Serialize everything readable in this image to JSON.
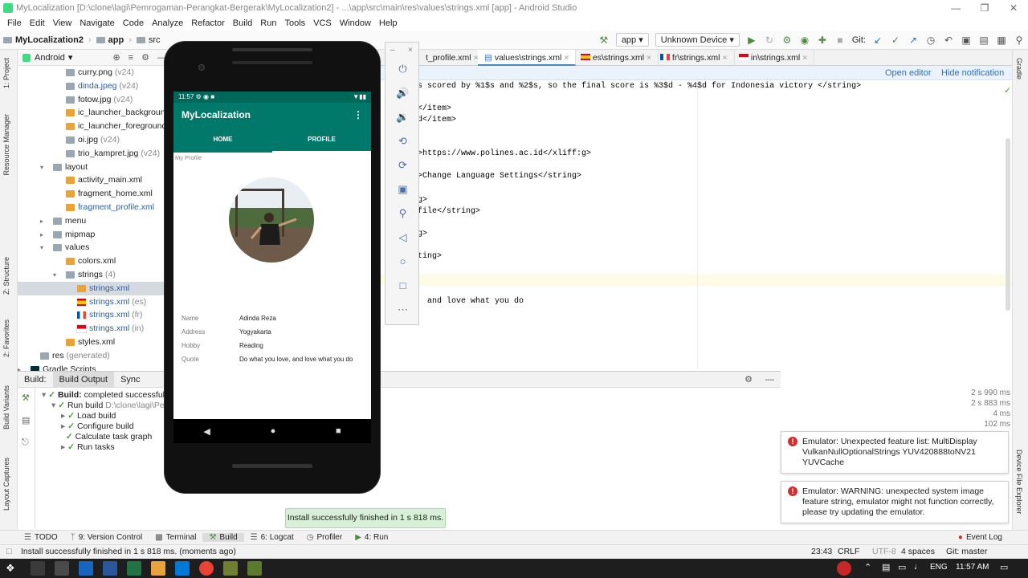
{
  "window": {
    "title": "MyLocalization [D:\\clone\\lagi\\Pemrogaman-Perangkat-Bergerak\\MyLocalization2] - ...\\app\\src\\main\\res\\values\\strings.xml [app] - Android Studio"
  },
  "menu": [
    "File",
    "Edit",
    "View",
    "Navigate",
    "Code",
    "Analyze",
    "Refactor",
    "Build",
    "Run",
    "Tools",
    "VCS",
    "Window",
    "Help"
  ],
  "breadcrumb": [
    "MyLocalization2",
    "app",
    "src",
    "main",
    "res",
    "values",
    "strings.xml"
  ],
  "toolbar": {
    "config": "app",
    "device": "Unknown Device",
    "git": "Git:"
  },
  "project": {
    "view": "Android",
    "items": [
      {
        "label": "curry.png",
        "suffix": "(v24)"
      },
      {
        "label": "dinda.jpeg",
        "suffix": "(v24)"
      },
      {
        "label": "fotow.jpg",
        "suffix": "(v24)"
      },
      {
        "label": "ic_launcher_background.",
        "suffix": ""
      },
      {
        "label": "ic_launcher_foreground.x",
        "suffix": ""
      },
      {
        "label": "oi.jpg",
        "suffix": "(v24)"
      },
      {
        "label": "trio_kampret.jpg",
        "suffix": "(v24)"
      },
      {
        "label": "layout",
        "suffix": ""
      },
      {
        "label": "activity_main.xml",
        "suffix": ""
      },
      {
        "label": "fragment_home.xml",
        "suffix": ""
      },
      {
        "label": "fragment_profile.xml",
        "suffix": ""
      },
      {
        "label": "menu",
        "suffix": ""
      },
      {
        "label": "mipmap",
        "suffix": ""
      },
      {
        "label": "values",
        "suffix": ""
      },
      {
        "label": "colors.xml",
        "suffix": ""
      },
      {
        "label": "strings",
        "suffix": "(4)"
      },
      {
        "label": "strings.xml",
        "suffix": ""
      },
      {
        "label": "strings.xml",
        "suffix": "(es)"
      },
      {
        "label": "strings.xml",
        "suffix": "(fr)"
      },
      {
        "label": "strings.xml",
        "suffix": "(in)"
      },
      {
        "label": "styles.xml",
        "suffix": ""
      },
      {
        "label": "res",
        "suffix": "(generated)"
      },
      {
        "label": "Gradle Scripts",
        "suffix": ""
      }
    ]
  },
  "tabs": [
    "t_profile.xml",
    "values\\strings.xml",
    "es\\strings.xml",
    "fr\\strings.xml",
    "in\\strings.xml"
  ],
  "editor": {
    "open_editor": "Open editor",
    "hide_notification": "Hide notification",
    "lines": [
      "s scored by %1$s and %2$s, so the final score is %3$d - %4$d for Indonesia victory </string>",
      "</item>",
      "d</item>",
      ">https://www.polines.ac.id</xliff:g>",
      ">Change Language Settings</string>",
      "g>",
      "file</string>",
      "g>",
      "ting>",
      "and love what you do"
    ]
  },
  "left_tools": [
    "1: Project",
    "Resource Manager",
    "Z: Structure",
    "2: Favorites",
    "Build Variants",
    "Layout Captures"
  ],
  "right_tools": [
    "Gradle",
    "Device File Explorer"
  ],
  "build": {
    "tabs": [
      "Build:",
      "Build Output",
      "Sync"
    ],
    "rows": [
      {
        "label": "Build:",
        "text": "completed successfully",
        "time": "2 s 990 ms"
      },
      {
        "label": "Run build",
        "text": "D:\\clone\\lagi\\Pe",
        "time": "2 s 883 ms"
      },
      {
        "label": "Load build",
        "text": "",
        "time": "4 ms"
      },
      {
        "label": "Configure build",
        "text": "",
        "time": "102 ms"
      },
      {
        "label": "Calculate task graph",
        "text": "",
        "time": ""
      },
      {
        "label": "Run tasks",
        "text": "",
        "time": ""
      }
    ]
  },
  "notifications": [
    "Emulator: Unexpected feature list: MultiDisplay VulkanNullOptionalStrings YUV420888toNV21 YUVCache",
    "Emulator: WARNING: unexpected system image feature string, emulator might not function correctly, please try updating the emulator."
  ],
  "toast": "Install successfully finished in 1 s 818 ms.",
  "bottom_tools": [
    "TODO",
    "9: Version Control",
    "Terminal",
    "Build",
    "6: Logcat",
    "Profiler",
    "4: Run",
    "Event Log"
  ],
  "status": {
    "message": "Install successfully finished in 1 s 818 ms. (moments ago)",
    "position": "23:43",
    "line_sep": "CRLF",
    "encoding": "UTF-8",
    "indent": "4 spaces",
    "branch": "Git: master"
  },
  "phone": {
    "time": "11:57",
    "app_title": "MyLocalization",
    "tabs": [
      "HOME",
      "PROFILE"
    ],
    "section": "My Profile",
    "fields": [
      {
        "k": "Name",
        "v": "Adinda Reza"
      },
      {
        "k": "Address",
        "v": "Yogyakarta"
      },
      {
        "k": "Hobby",
        "v": "Reading"
      },
      {
        "k": "Quote",
        "v": "Do what you love, and love what you do"
      }
    ]
  },
  "taskbar": {
    "lang": "ENG",
    "clock": "11:57 AM"
  },
  "colors": {
    "teal": "#00796b",
    "teal_dark": "#00675b",
    "accent": "#4a88c7"
  }
}
